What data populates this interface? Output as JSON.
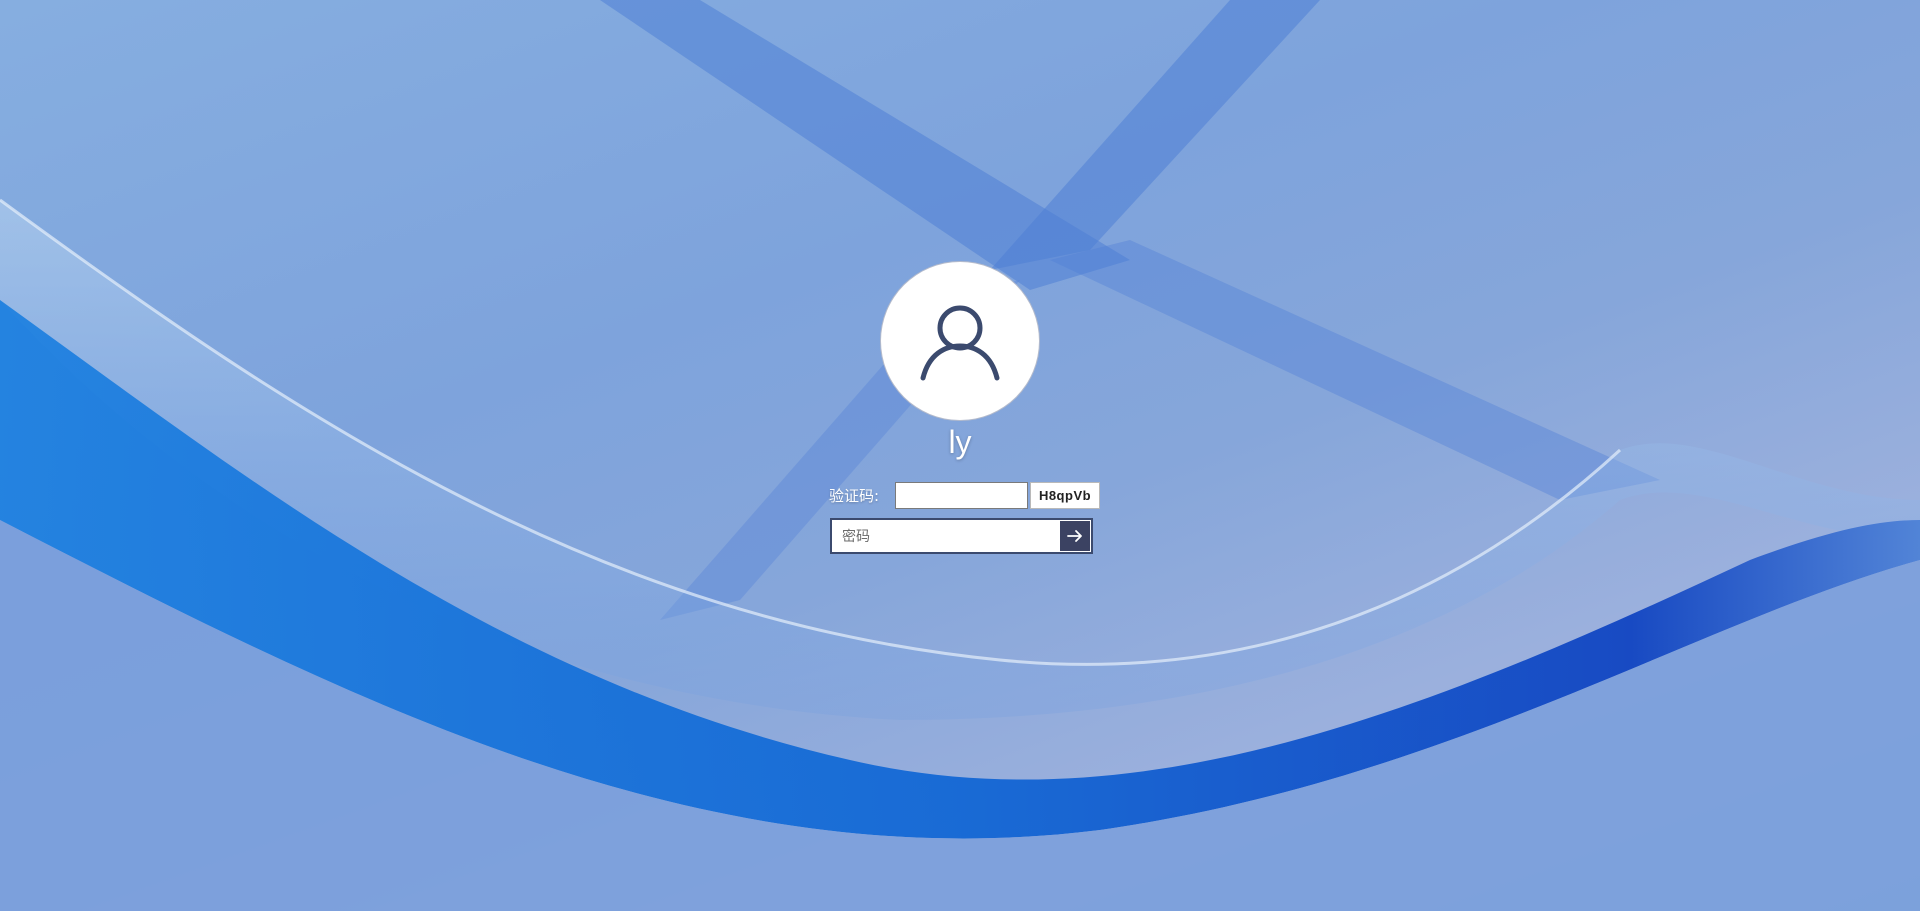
{
  "user": {
    "name": "ly",
    "avatar_icon": "user-icon"
  },
  "captcha": {
    "label": "验证码:",
    "value": "",
    "code": "H8qpVb"
  },
  "password": {
    "placeholder": "密码",
    "value": "",
    "submit_icon": "arrow-right-icon"
  },
  "colors": {
    "avatar_icon": "#3b4a6e",
    "submit_bg": "#3b4262",
    "wallpaper_base": "#7ea3dc",
    "wallpaper_ribbon": "#0a5fd0"
  }
}
